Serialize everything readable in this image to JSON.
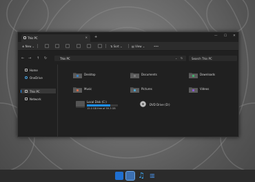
{
  "window": {
    "tab_title": "This PC",
    "tab_close": "✕",
    "new_tab": "+",
    "controls": {
      "minimize": "—",
      "maximize": "☐",
      "close": "✕"
    }
  },
  "toolbar": {
    "new_label": "New",
    "sort_label": "Sort",
    "view_label": "View",
    "more_label": "•••"
  },
  "address": {
    "back": "←",
    "forward": "→",
    "path": "This PC",
    "search_placeholder": "Search This PC"
  },
  "sidebar": {
    "items": [
      {
        "label": "Home",
        "icon": "home-icon"
      },
      {
        "label": "OneDrive",
        "icon": "cloud-icon"
      },
      {
        "label": "This PC",
        "icon": "computer-icon",
        "selected": true
      },
      {
        "label": "Network",
        "icon": "network-icon"
      }
    ]
  },
  "folders": [
    {
      "label": "Desktop",
      "icon": "folder-desktop-icon",
      "color": "#3b82c4"
    },
    {
      "label": "Documents",
      "icon": "folder-documents-icon",
      "color": "#7a7a7a"
    },
    {
      "label": "Downloads",
      "icon": "folder-downloads-icon",
      "color": "#3fae6a"
    },
    {
      "label": "Music",
      "icon": "folder-music-icon",
      "color": "#d26a4a"
    },
    {
      "label": "Pictures",
      "icon": "folder-pictures-icon",
      "color": "#4aa6d2"
    },
    {
      "label": "Videos",
      "icon": "folder-videos-icon",
      "color": "#8a5ad2"
    }
  ],
  "drives": [
    {
      "label": "Local Disk (C:)",
      "free_text": "15.0 GB free of 59.3 GB",
      "used_fraction": 0.75,
      "icon": "hard-drive-icon"
    },
    {
      "label": "DVD Drive (D:)",
      "icon": "dvd-drive-icon"
    }
  ],
  "colors": {
    "accent": "#1e90ff",
    "window_bg": "#202020"
  }
}
